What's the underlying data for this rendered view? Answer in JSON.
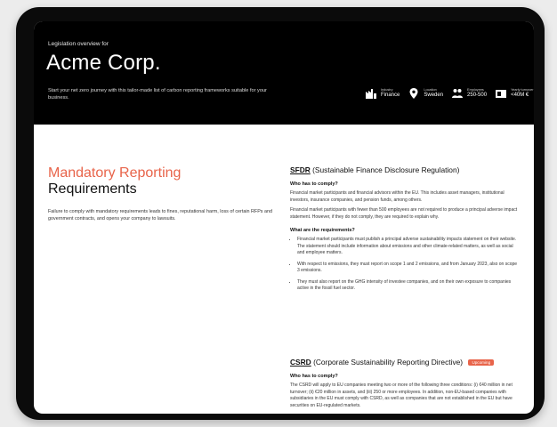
{
  "header": {
    "eyebrow": "Legislation overview for",
    "company": "Acme Corp.",
    "subtitle": "Start your net zero journey with this tailor-made list of carbon reporting frameworks suitable for your business."
  },
  "facts": [
    {
      "icon": "industry-icon",
      "label": "Industry",
      "value": "Finance"
    },
    {
      "icon": "location-pin-icon",
      "label": "Location",
      "value": "Sweden"
    },
    {
      "icon": "people-icon",
      "label": "Employees",
      "value": "250-500"
    },
    {
      "icon": "turnover-icon",
      "label": "Yearly turnover",
      "value": "<40M €"
    }
  ],
  "section": {
    "title_accent": "Mandatory Reporting",
    "title_main": "Requirements",
    "description": "Failure to comply with mandatory requirements leads to fines, reputational harm, loss of certain RFPs and government contracts, and opens your company to lawsuits."
  },
  "sfdr": {
    "abbr": "SFDR",
    "full": "(Sustainable Finance Disclosure Regulation)",
    "who_heading": "Who has to comply?",
    "who_p1": "Financial market participants and financial advisors within the EU. This includes asset managers, institutional investors, insurance companies, and pension funds, among others.",
    "who_p2": "Financial market participants with fewer than 500 employees are not required to produce a principal adverse impact statement. However, if they do not comply, they are required to explain why.",
    "req_heading": "What are the requirements?",
    "requirements": [
      "Financial market participants must publish a principal adverse sustainability impacts statement on their website. The statement should include information about emissions and other climate-related matters, as well as social and employee matters.",
      "With respect to emissions, they must report on scope 1 and 2 emissions, and from January 2023, also on scope 3 emissions.",
      "They must also report on the GHG intensity of investee companies, and on their own exposure to companies active in the fossil fuel sector."
    ]
  },
  "csrd": {
    "abbr": "CSRD",
    "full": "(Corporate Sustainability Reporting Directive)",
    "badge": "Upcoming",
    "who_heading": "Who has to comply?",
    "who_p1": "The CSRD will apply to EU companies meeting two or more of the following three conditions: (i) €40 million in net turnover; (ii) €20 million in assets, and (iii) 250 or more employees. In addition, non-EU-based companies with subsidiaries in the EU must comply with CSRD, as well as companies that are not established in the EU but have securities on EU-regulated markets."
  },
  "colors": {
    "accent": "#e8644a",
    "hero_bg": "#000000",
    "bezel": "#0b0b0b"
  }
}
